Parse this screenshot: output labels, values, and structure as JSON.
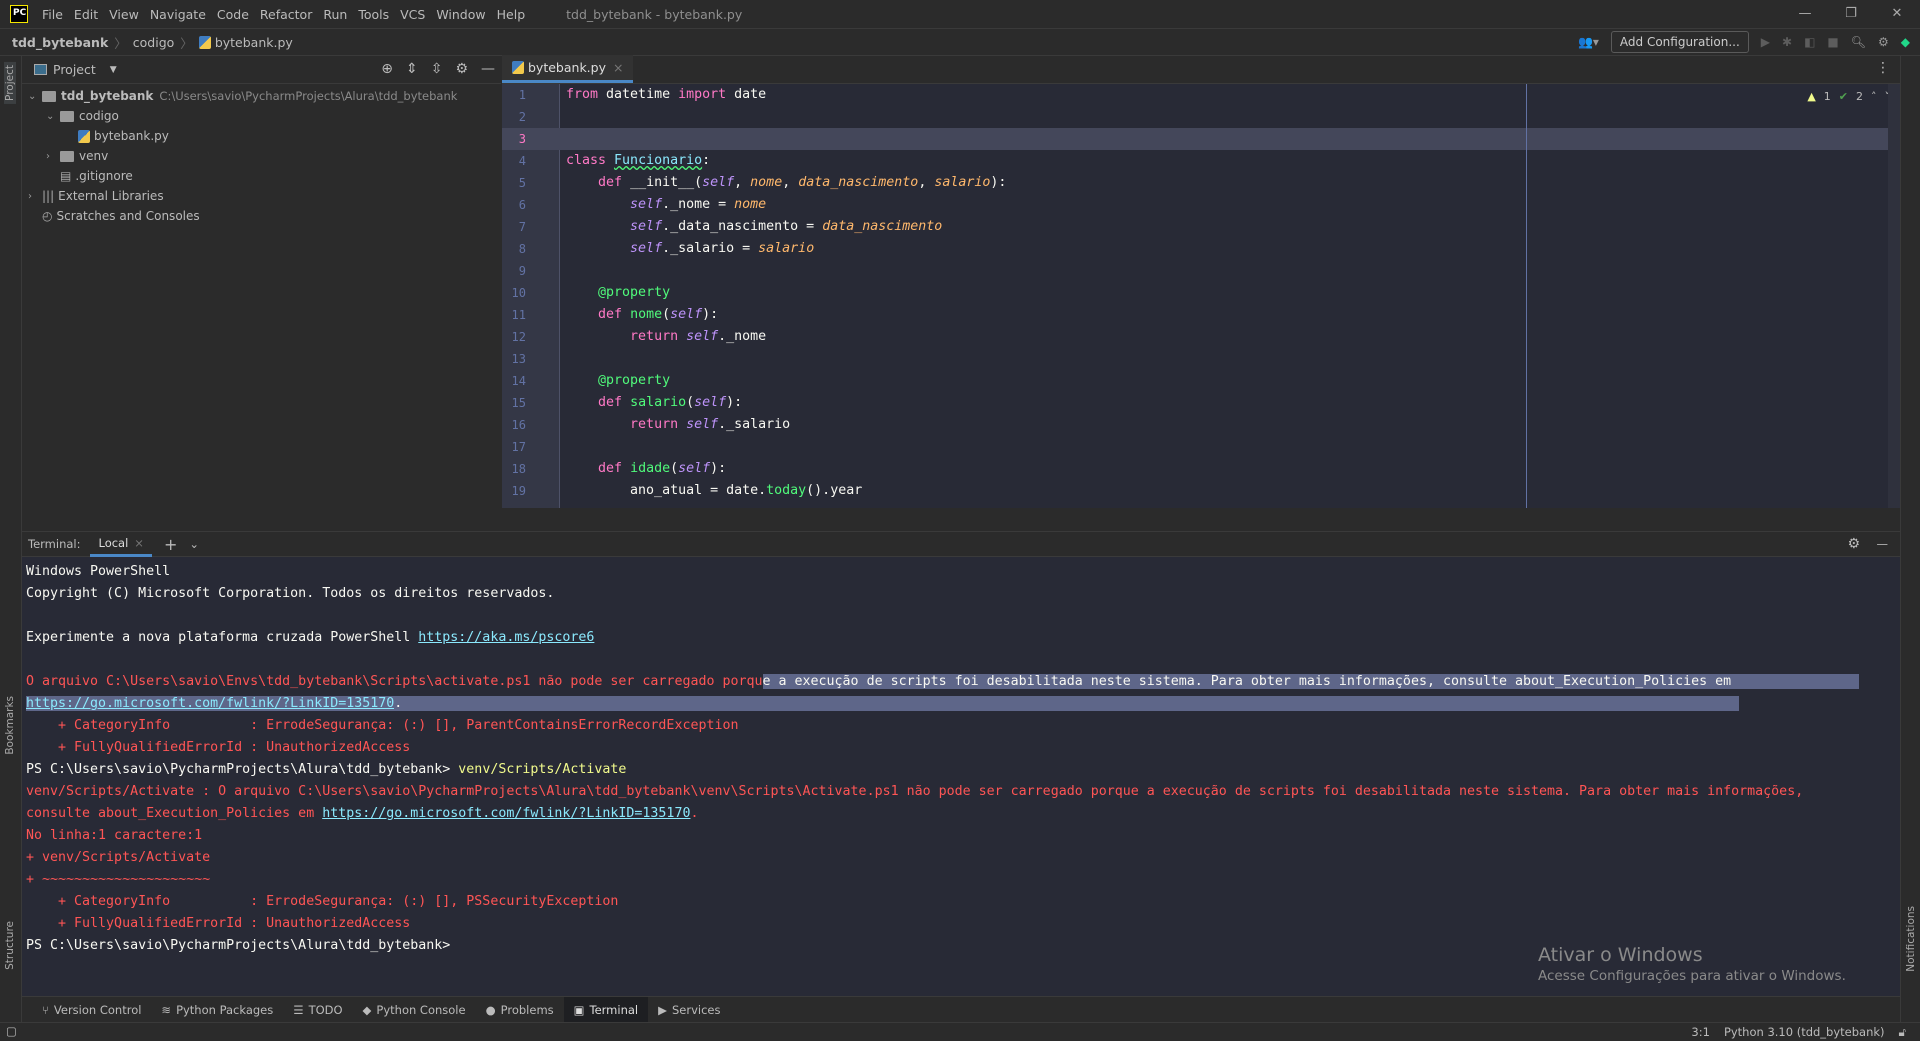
{
  "app": {
    "logo": "PC",
    "window_title": "tdd_bytebank - bytebank.py"
  },
  "menu": [
    "File",
    "Edit",
    "View",
    "Navigate",
    "Code",
    "Refactor",
    "Run",
    "Tools",
    "VCS",
    "Window",
    "Help"
  ],
  "breadcrumb": [
    "tdd_bytebank",
    "codigo",
    "bytebank.py"
  ],
  "toolbar": {
    "add_configuration": "Add Configuration..."
  },
  "sidebar_left": {
    "project": "Project",
    "bookmarks": "Bookmarks",
    "structure": "Structure"
  },
  "sidebar_right": {
    "notifications": "Notifications"
  },
  "project": {
    "title": "Project",
    "tree": [
      {
        "label": "tdd_bytebank",
        "path": "C:\\Users\\savio\\PycharmProjects\\Alura\\tdd_bytebank",
        "depth": 0,
        "arrow": "open",
        "icon": "folder"
      },
      {
        "label": "codigo",
        "depth": 1,
        "arrow": "open",
        "icon": "folder"
      },
      {
        "label": "bytebank.py",
        "depth": 2,
        "arrow": "",
        "icon": "python"
      },
      {
        "label": "venv",
        "depth": 1,
        "arrow": "closed",
        "icon": "folder"
      },
      {
        "label": ".gitignore",
        "depth": 1,
        "arrow": "",
        "icon": "file"
      },
      {
        "label": "External Libraries",
        "depth": 0,
        "arrow": "closed",
        "icon": "library"
      },
      {
        "label": "Scratches and Consoles",
        "depth": 0,
        "arrow": "",
        "icon": "scratch"
      }
    ]
  },
  "editor": {
    "tab": "bytebank.py",
    "warnings": "1",
    "weak_warnings": "2",
    "current_line": 3,
    "lines": [
      [
        [
          "from",
          "k"
        ],
        " datetime ",
        [
          "import",
          "k"
        ],
        " date"
      ],
      [],
      [],
      [
        [
          "class",
          "k"
        ],
        " ",
        [
          "Funcionario",
          "c"
        ],
        ":"
      ],
      [
        "    ",
        [
          "def",
          "k"
        ],
        " __init__(",
        [
          "self",
          "s"
        ],
        ", ",
        [
          "nome",
          "p"
        ],
        ", ",
        [
          "data_nascimento",
          "p"
        ],
        ", ",
        [
          "salario",
          "p"
        ],
        "):"
      ],
      [
        "        ",
        [
          "self",
          "s"
        ],
        "._nome = ",
        [
          "nome",
          "p"
        ]
      ],
      [
        "        ",
        [
          "self",
          "s"
        ],
        "._data_nascimento = ",
        [
          "data_nascimento",
          "p"
        ]
      ],
      [
        "        ",
        [
          "self",
          "s"
        ],
        "._salario = ",
        [
          "salario",
          "p"
        ]
      ],
      [],
      [
        "    ",
        [
          "@property",
          "g"
        ]
      ],
      [
        "    ",
        [
          "def",
          "k"
        ],
        " ",
        [
          "nome",
          "g"
        ],
        "(",
        [
          "self",
          "s"
        ],
        "):"
      ],
      [
        "        ",
        [
          "return",
          "k"
        ],
        " ",
        [
          "self",
          "s"
        ],
        "._nome"
      ],
      [],
      [
        "    ",
        [
          "@property",
          "g"
        ]
      ],
      [
        "    ",
        [
          "def",
          "k"
        ],
        " ",
        [
          "salario",
          "g"
        ],
        "(",
        [
          "self",
          "s"
        ],
        "):"
      ],
      [
        "        ",
        [
          "return",
          "k"
        ],
        " ",
        [
          "self",
          "s"
        ],
        "._salario"
      ],
      [],
      [
        "    ",
        [
          "def",
          "k"
        ],
        " ",
        [
          "idade",
          "g"
        ],
        "(",
        [
          "self",
          "s"
        ],
        "):"
      ],
      [
        "        ano_atual = date.",
        [
          "today",
          "g"
        ],
        "().year"
      ]
    ]
  },
  "terminal": {
    "label": "Terminal:",
    "tab": "Local",
    "lines": [
      [
        "Windows PowerShell"
      ],
      [
        "Copyright (C) Microsoft Corporation. Todos os direitos reservados."
      ],
      [],
      [
        "Experimente a nova plataforma cruzada PowerShell ",
        [
          "https://aka.ms/pscore6",
          "l"
        ]
      ],
      [],
      [
        [
          "O arquivo C:\\Users\\savio\\Envs\\tdd_bytebank\\Scripts\\activate.ps1 não pode ser carregado porqu",
          "r"
        ],
        [
          "e a execução de scripts foi desabilitada neste sistema. Para obter mais informações, consulte about_Execution_Policies em                ",
          "sel"
        ]
      ],
      [
        [
          "https://go.microsoft.com/fwlink/?LinkID=135170",
          "l sel"
        ],
        [
          ".                                                                                                                                                                       ",
          "sel"
        ]
      ],
      [
        [
          "    + CategoryInfo          : ErrodeSegurança: (:) [], ParentContainsErrorRecordException",
          "r"
        ]
      ],
      [
        [
          "    + FullyQualifiedErrorId : UnauthorizedAccess",
          "r"
        ]
      ],
      [
        "PS C:\\Users\\savio\\PycharmProjects\\Alura\\tdd_bytebank> ",
        [
          "venv/Scripts/Activate",
          "y"
        ]
      ],
      [
        [
          "venv/Scripts/Activate : O arquivo C:\\Users\\savio\\PycharmProjects\\Alura\\tdd_bytebank\\venv\\Scripts\\Activate.ps1 não pode ser carregado porque a execução de scripts foi desabilitada neste sistema. Para obter mais informações,",
          "r"
        ]
      ],
      [
        [
          "consulte about_Execution_Policies em ",
          "r"
        ],
        [
          "https://go.microsoft.com/fwlink/?LinkID=135170",
          "l"
        ],
        [
          ".",
          "r"
        ]
      ],
      [
        [
          "No linha:1 caractere:1",
          "r"
        ]
      ],
      [
        [
          "+ venv/Scripts/Activate",
          "r"
        ]
      ],
      [
        [
          "+ ~~~~~~~~~~~~~~~~~~~~~",
          "r"
        ]
      ],
      [
        [
          "    + CategoryInfo          : ErrodeSegurança: (:) [], PSSecurityException",
          "r"
        ]
      ],
      [
        [
          "    + FullyQualifiedErrorId : UnauthorizedAccess",
          "r"
        ]
      ],
      [
        "PS C:\\Users\\savio\\PycharmProjects\\Alura\\tdd_bytebank>"
      ]
    ]
  },
  "watermark": {
    "title": "Ativar o Windows",
    "subtitle": "Acesse Configurações para ativar o Windows."
  },
  "tool_windows": [
    {
      "label": "Version Control",
      "icon": "⑂"
    },
    {
      "label": "Python Packages",
      "icon": "≋"
    },
    {
      "label": "TODO",
      "icon": "☰"
    },
    {
      "label": "Python Console",
      "icon": "◆"
    },
    {
      "label": "Problems",
      "icon": "●"
    },
    {
      "label": "Terminal",
      "icon": "▣",
      "active": true
    },
    {
      "label": "Services",
      "icon": "▶"
    }
  ],
  "status": {
    "position": "3:1",
    "interpreter": "Python 3.10 (tdd_bytebank)"
  }
}
